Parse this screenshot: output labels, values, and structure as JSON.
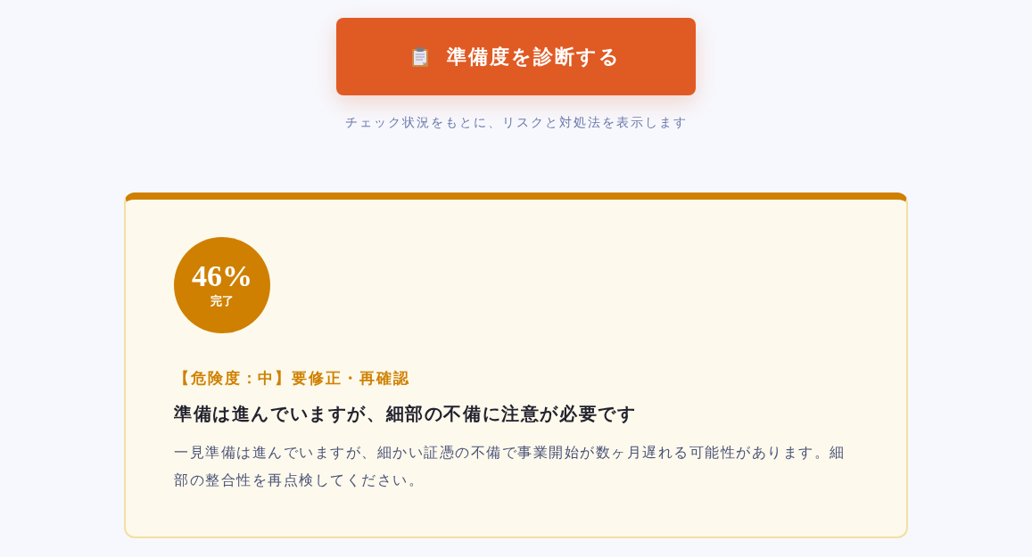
{
  "diagnose_button": {
    "label": "準備度を診断する"
  },
  "hint": "チェック状況をもとに、リスクと対処法を表示します",
  "result_card": {
    "percent": "46%",
    "percent_caption": "完了",
    "risk_label": "【危険度：中】要修正・再確認",
    "title": "準備は進んでいますが、細部の不備に注意が必要です",
    "description": "一見準備は進んでいますが、細かい証憑の不備で事業開始が数ヶ月遅れる可能性があります。細部の整合性を再点検してください。"
  }
}
